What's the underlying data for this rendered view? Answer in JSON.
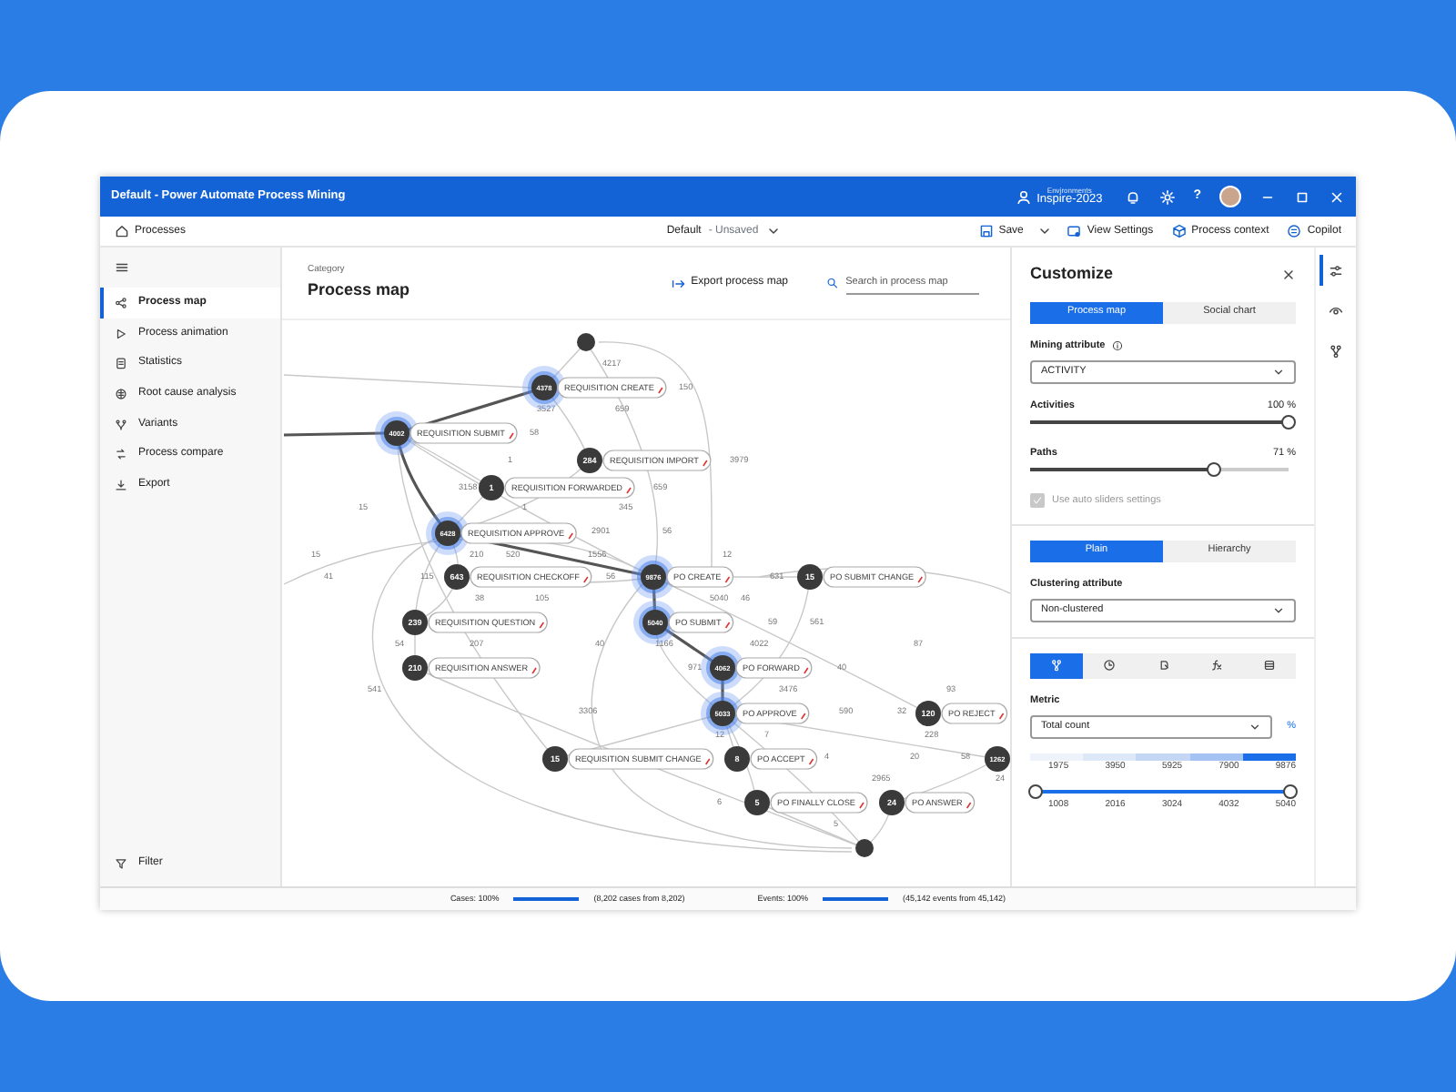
{
  "window": {
    "title": "Default - Power Automate Process Mining",
    "environment_label": "Environments",
    "environment": "Inspire-2023",
    "help": "?"
  },
  "toolbar": {
    "breadcrumb": "Processes",
    "view": "Default",
    "view_state": "- Unsaved",
    "actions": [
      "Save",
      "View Settings",
      "Process context",
      "Copilot"
    ]
  },
  "nav": {
    "items": [
      {
        "label": "Process map",
        "selected": true
      },
      {
        "label": "Process animation",
        "selected": false
      },
      {
        "label": "Statistics",
        "selected": false
      },
      {
        "label": "Root cause analysis",
        "selected": false
      },
      {
        "label": "Variants",
        "selected": false
      },
      {
        "label": "Process compare",
        "selected": false
      },
      {
        "label": "Export",
        "selected": false
      }
    ],
    "filter": "Filter"
  },
  "header": {
    "category": "Category",
    "title": "Process map",
    "export": "Export process map",
    "search_placeholder": "Search in process map"
  },
  "map": {
    "nodes": [
      {
        "kind": "start"
      },
      {
        "kind": "activity",
        "count": "4378",
        "label": "REQUISITION CREATE",
        "highlight": true
      },
      {
        "kind": "activity",
        "count": "4002",
        "label": "REQUISITION SUBMIT",
        "highlight": true
      },
      {
        "kind": "activity",
        "count": "284",
        "label": "REQUISITION IMPORT",
        "highlight": false
      },
      {
        "kind": "activity",
        "count": "1",
        "label": "REQUISITION FORWARDED",
        "highlight": false
      },
      {
        "kind": "activity",
        "count": "6428",
        "label": "REQUISITION APPROVE",
        "highlight": true
      },
      {
        "kind": "activity",
        "count": "643",
        "label": "REQUISITION CHECKOFF",
        "highlight": false
      },
      {
        "kind": "activity",
        "count": "239",
        "label": "REQUISITION QUESTION",
        "highlight": false
      },
      {
        "kind": "activity",
        "count": "210",
        "label": "REQUISITION ANSWER",
        "highlight": false
      },
      {
        "kind": "activity",
        "count": "9876",
        "label": "PO CREATE",
        "highlight": true
      },
      {
        "kind": "activity",
        "count": "5040",
        "label": "PO SUBMIT",
        "highlight": true
      },
      {
        "kind": "activity",
        "count": "4062",
        "label": "PO FORWARD",
        "highlight": true
      },
      {
        "kind": "activity",
        "count": "5033",
        "label": "PO APPROVE",
        "highlight": true
      },
      {
        "kind": "activity",
        "count": "15",
        "label": "REQUISITION SUBMIT CHANGE",
        "highlight": false
      },
      {
        "kind": "activity",
        "count": "8",
        "label": "PO ACCEPT",
        "highlight": false
      },
      {
        "kind": "activity",
        "count": "5",
        "label": "PO FINALLY CLOSE",
        "highlight": false
      },
      {
        "kind": "activity",
        "count": "24",
        "label": "PO ANSWER",
        "highlight": false
      },
      {
        "kind": "activity",
        "count": "120",
        "label": "PO REJECT",
        "highlight": false
      },
      {
        "kind": "activity",
        "count": "1262",
        "highlight": false
      },
      {
        "kind": "activity",
        "count": "15",
        "label": "PO SUBMIT CHANGE",
        "highlight": false
      },
      {
        "kind": "end"
      }
    ],
    "edge_labels": [
      "4217",
      "150",
      "3527",
      "659",
      "58",
      "1",
      "3979",
      "3158",
      "659",
      "15",
      "1",
      "345",
      "2901",
      "56",
      "15",
      "210",
      "520",
      "1556",
      "12",
      "41",
      "115",
      "56",
      "631",
      "38",
      "105",
      "5040",
      "46",
      "59",
      "561",
      "54",
      "207",
      "40",
      "1166",
      "4022",
      "87",
      "971",
      "40",
      "541",
      "3476",
      "93",
      "3306",
      "590",
      "32",
      "12",
      "7",
      "228",
      "4",
      "20",
      "58",
      "2965",
      "24",
      "6",
      "5"
    ]
  },
  "customize": {
    "title": "Customize",
    "view_tabs": [
      {
        "label": "Process map",
        "selected": true
      },
      {
        "label": "Social chart",
        "selected": false
      }
    ],
    "mining_attribute": {
      "label": "Mining attribute",
      "value": "ACTIVITY"
    },
    "sliders": [
      {
        "label": "Activities",
        "reading": "100 %",
        "level": 1
      },
      {
        "label": "Paths",
        "reading": "71 %",
        "level": 0.71
      }
    ],
    "auto_sliders": {
      "label": "Use auto sliders settings",
      "checked": true,
      "disabled": true
    },
    "layout_tabs": [
      {
        "label": "Plain",
        "selected": true
      },
      {
        "label": "Hierarchy",
        "selected": false
      }
    ],
    "clustering": {
      "label": "Clustering attribute",
      "value": "Non-clustered"
    },
    "metric_tabs": [
      {
        "kind": "frequency",
        "selected": true
      },
      {
        "kind": "time",
        "selected": false
      },
      {
        "kind": "rework",
        "selected": false
      },
      {
        "kind": "formula",
        "selected": false
      },
      {
        "kind": "table",
        "selected": false
      }
    ],
    "metric": {
      "label": "Metric",
      "value": "Total count",
      "unit": "%"
    },
    "legend": [
      {
        "value": "1975",
        "color": "#eef3fb"
      },
      {
        "value": "3950",
        "color": "#dde8f8"
      },
      {
        "value": "5925",
        "color": "#c3d7f5"
      },
      {
        "value": "7900",
        "color": "#a5c3f2"
      },
      {
        "value": "9876",
        "color": "#1a6ee8"
      }
    ],
    "range": {
      "thumbs": [
        {
          "level": 0
        },
        {
          "level": 1
        }
      ],
      "ticks": [
        "1008",
        "2016",
        "3024",
        "4032",
        "5040"
      ]
    }
  },
  "rail": [
    {
      "selected": true
    },
    {
      "selected": false
    },
    {
      "selected": false
    }
  ],
  "status": [
    {
      "label": "Cases: 100%",
      "level": 1,
      "detail": "(8,202 cases from 8,202)"
    },
    {
      "label": "Events: 100%",
      "level": 1,
      "detail": "(45,142 events from 45,142)"
    }
  ]
}
